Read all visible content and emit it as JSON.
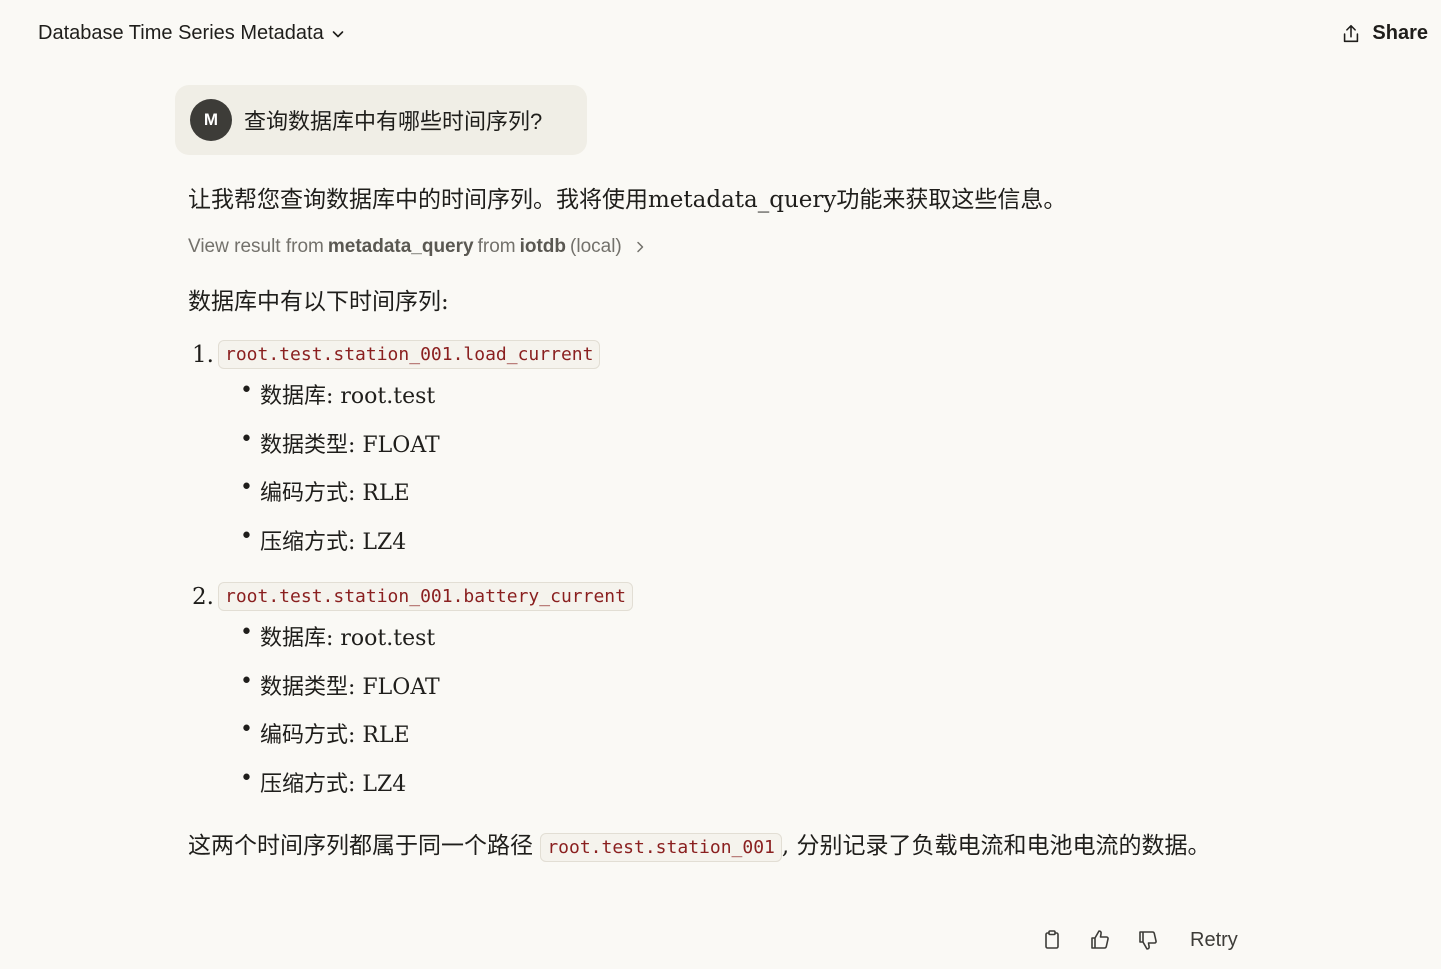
{
  "header": {
    "title": "Database Time Series Metadata",
    "share_label": "Share"
  },
  "user_message": {
    "avatar_initial": "M",
    "text": "查询数据库中有哪些时间序列?"
  },
  "assistant": {
    "intro": "让我帮您查询数据库中的时间序列。我将使用metadata_query功能来获取这些信息。",
    "tool_result": {
      "prefix": "View result from",
      "tool": "metadata_query",
      "from": "from",
      "server": "iotdb",
      "suffix": "(local)"
    },
    "list_heading": "数据库中有以下时间序列:",
    "series": [
      {
        "number": "1.",
        "path": "root.test.station_001.load_current",
        "details": [
          "数据库: root.test",
          "数据类型: FLOAT",
          "编码方式: RLE",
          "压缩方式: LZ4"
        ]
      },
      {
        "number": "2.",
        "path": "root.test.station_001.battery_current",
        "details": [
          "数据库: root.test",
          "数据类型: FLOAT",
          "编码方式: RLE",
          "压缩方式: LZ4"
        ]
      }
    ],
    "summary_before": "这两个时间序列都属于同一个路径",
    "summary_code": "root.test.station_001",
    "summary_after": ", 分别记录了负载电流和电池电流的数据。"
  },
  "actions": {
    "retry_label": "Retry"
  }
}
